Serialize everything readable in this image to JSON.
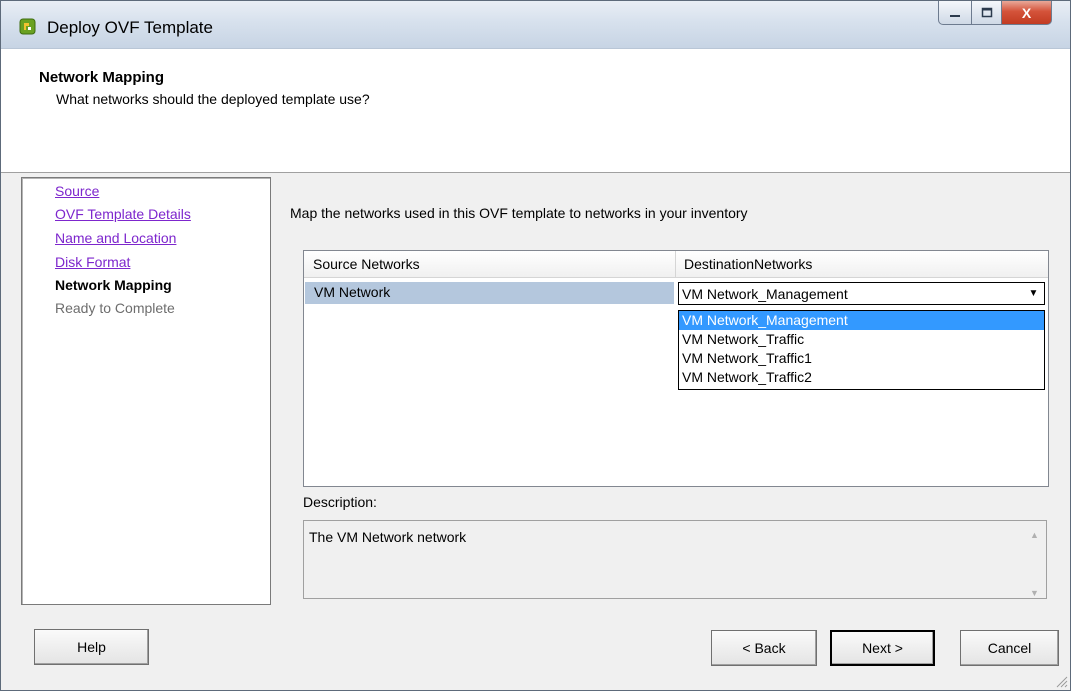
{
  "window": {
    "title": "Deploy OVF Template",
    "caption_buttons": {
      "close_label": "X"
    }
  },
  "header": {
    "title": "Network Mapping",
    "subtitle": "What networks should the deployed template use?"
  },
  "nav": {
    "items": [
      {
        "label": "Source",
        "state": "link"
      },
      {
        "label": "OVF Template Details",
        "state": "link"
      },
      {
        "label": "Name and Location",
        "state": "link"
      },
      {
        "label": "Disk Format",
        "state": "link"
      },
      {
        "label": "Network Mapping",
        "state": "current"
      },
      {
        "label": "Ready to Complete",
        "state": "disabled"
      }
    ]
  },
  "main": {
    "instructions": "Map the networks used in this OVF template to networks in your inventory",
    "grid": {
      "columns": [
        "Source Networks",
        "DestinationNetworks"
      ],
      "rows": [
        {
          "source": "VM Network",
          "destination": "VM Network_Management"
        }
      ]
    },
    "dropdown": {
      "options": [
        "VM Network_Management",
        "VM Network_Traffic",
        "VM Network_Traffic1",
        "VM Network_Traffic2"
      ],
      "selected": "VM Network_Management"
    },
    "description": {
      "label": "Description:",
      "text": "The VM Network network"
    }
  },
  "buttons": {
    "help": "Help",
    "back": "< Back",
    "next": "Next >",
    "cancel": "Cancel"
  },
  "colors": {
    "link": "#7d26cd",
    "selection": "#3399ff",
    "row_highlight": "#b4c7dd",
    "close_button": "#c23b22"
  }
}
